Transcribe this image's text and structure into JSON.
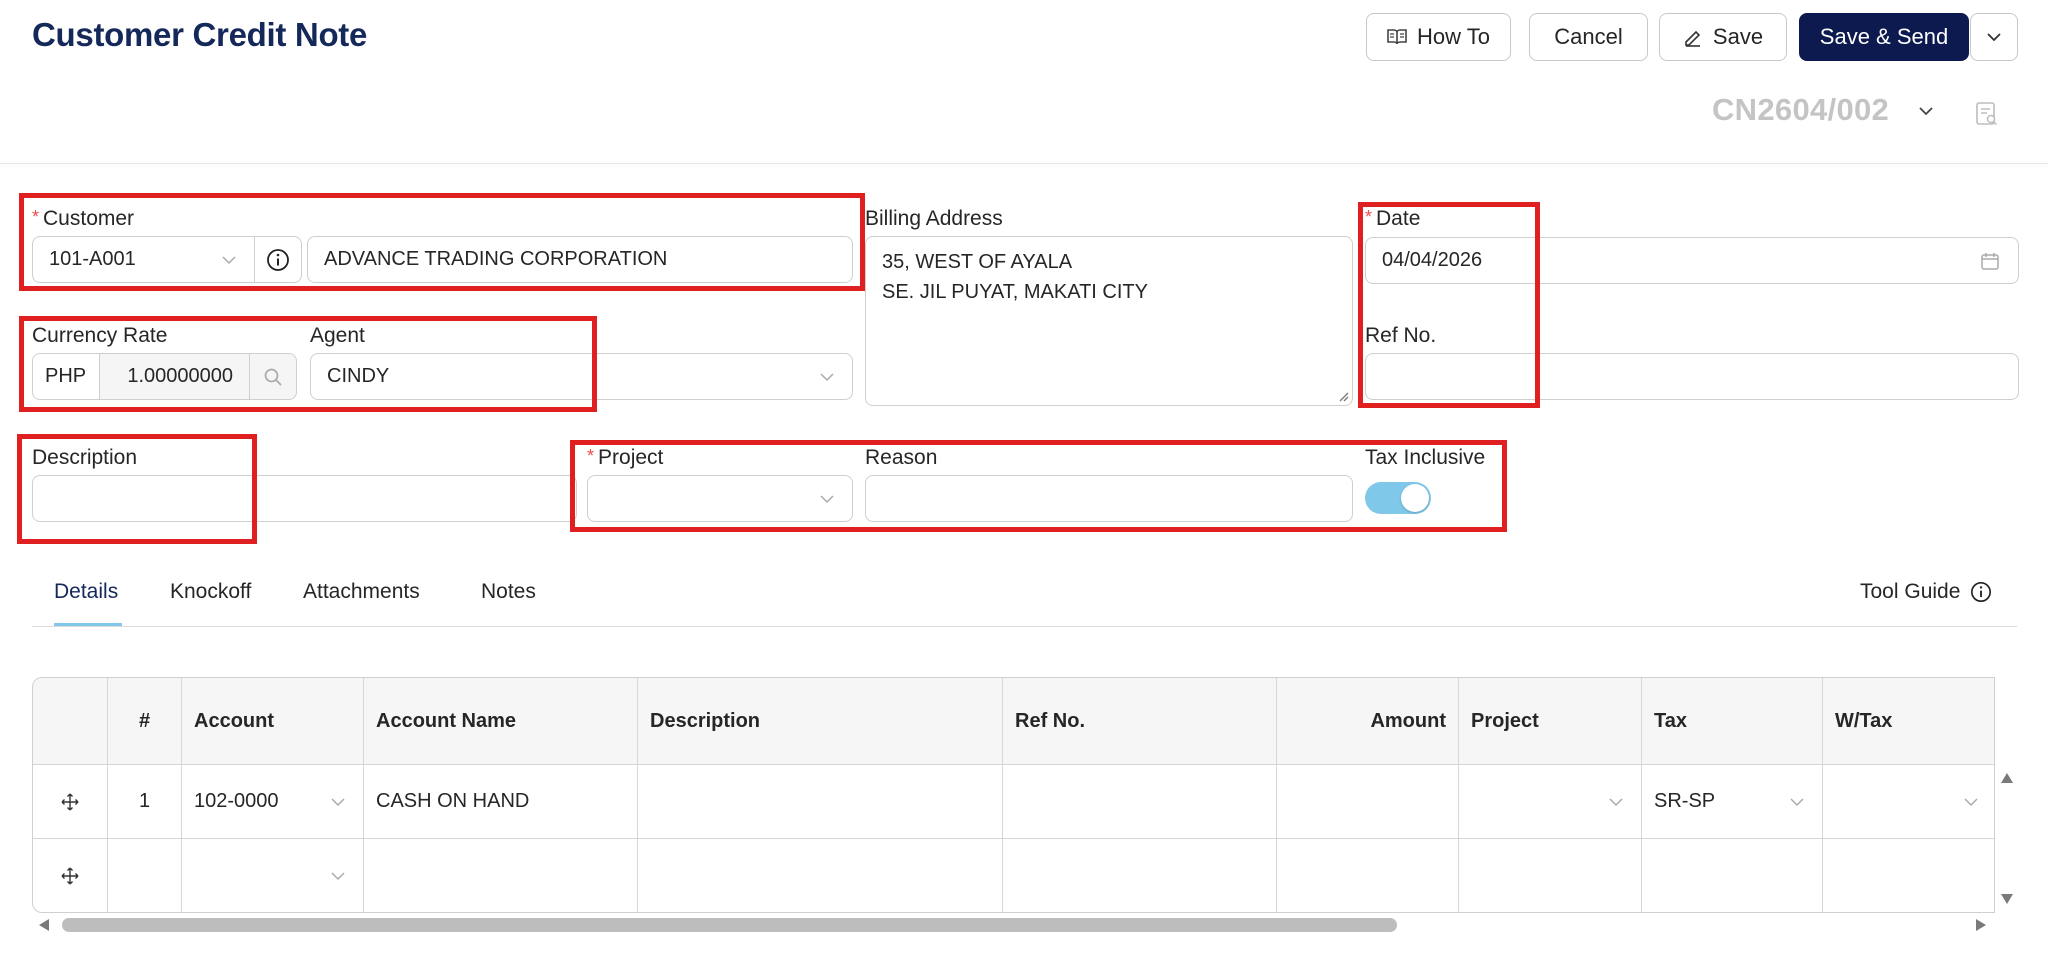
{
  "header": {
    "title": "Customer Credit Note",
    "how_to_label": "How To",
    "cancel_label": "Cancel",
    "save_label": "Save",
    "save_send_label": "Save & Send",
    "doc_number": "CN2604/002"
  },
  "form": {
    "customer": {
      "label": "Customer",
      "code": "101-A001",
      "name": "ADVANCE TRADING CORPORATION"
    },
    "billing_address": {
      "label": "Billing Address",
      "line1": "35, WEST OF AYALA",
      "line2": "SE. JIL PUYAT, MAKATI CITY"
    },
    "date": {
      "label": "Date",
      "value": "04/04/2026"
    },
    "ref_no": {
      "label": "Ref No.",
      "value": ""
    },
    "currency_rate": {
      "label": "Currency Rate",
      "currency": "PHP",
      "rate": "1.00000000"
    },
    "agent": {
      "label": "Agent",
      "value": "CINDY"
    },
    "description": {
      "label": "Description",
      "value": ""
    },
    "project": {
      "label": "Project",
      "value": ""
    },
    "reason": {
      "label": "Reason",
      "value": ""
    },
    "tax_inclusive": {
      "label": "Tax Inclusive",
      "value": true
    }
  },
  "tabs": [
    {
      "label": "Details",
      "active": true
    },
    {
      "label": "Knockoff",
      "active": false
    },
    {
      "label": "Attachments",
      "active": false
    },
    {
      "label": "Notes",
      "active": false
    }
  ],
  "tool_guide_label": "Tool Guide",
  "table": {
    "columns": [
      "#",
      "Account",
      "Account Name",
      "Description",
      "Ref No.",
      "Amount",
      "Project",
      "Tax",
      "W/Tax"
    ],
    "rows": [
      {
        "num": "1",
        "account": "102-0000",
        "account_name": "CASH ON HAND",
        "description": "",
        "ref_no": "",
        "amount": "",
        "project": "",
        "tax": "SR-SP",
        "wtax": ""
      },
      {
        "num": "",
        "account": "",
        "account_name": "",
        "description": "",
        "ref_no": "",
        "amount": "",
        "project": "",
        "tax": "",
        "wtax": ""
      }
    ]
  },
  "colors": {
    "primary": "#0c1a4f",
    "title": "#14285a",
    "highlight": "#e02020",
    "toggle": "#7fc8ea"
  }
}
